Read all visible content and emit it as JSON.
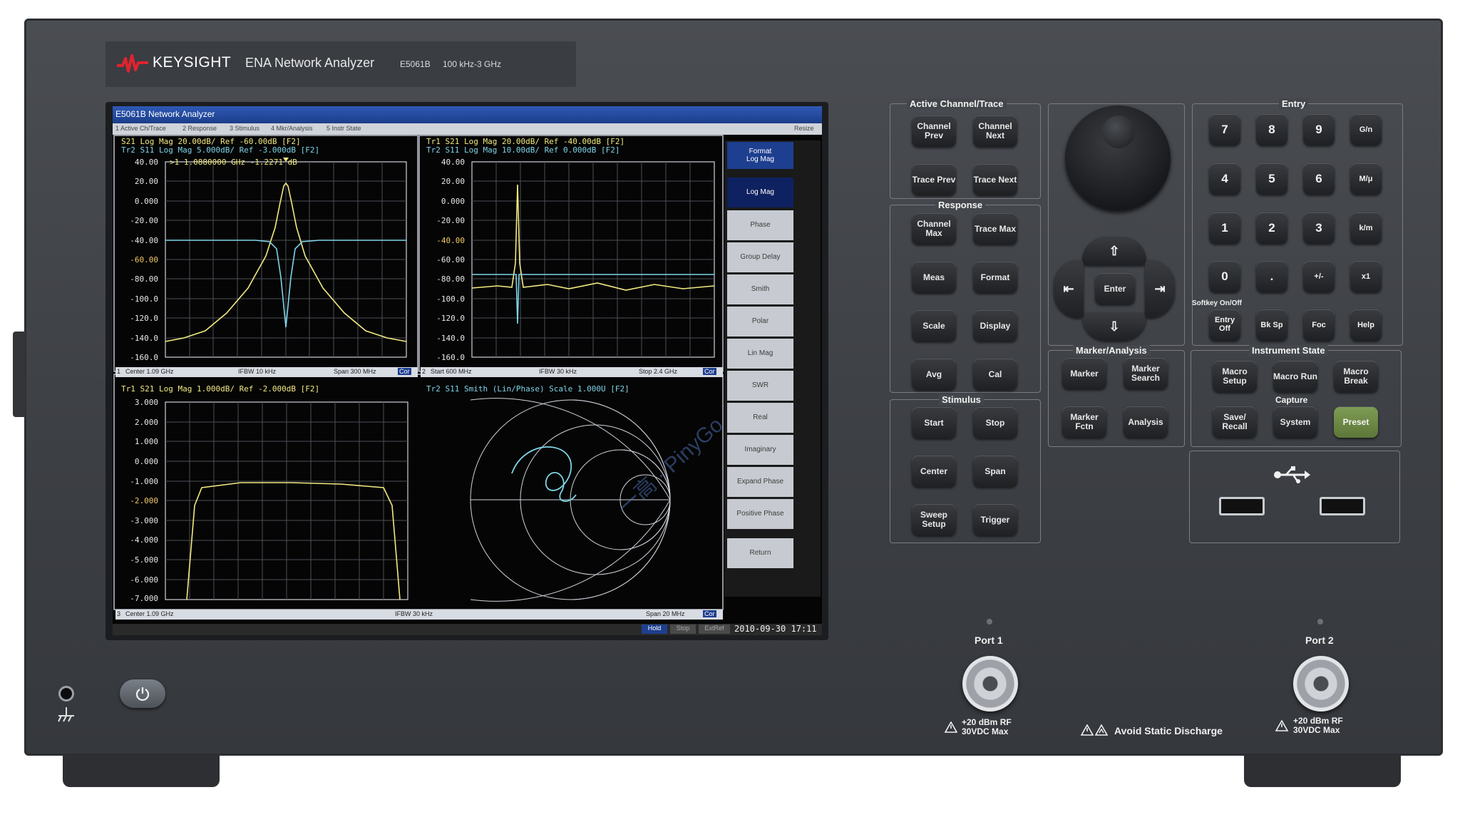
{
  "brand": {
    "logo_text": "KEYSIGHT",
    "product": "ENA Network Analyzer",
    "model": "E5061B",
    "range": "100 kHz-3 GHz"
  },
  "screen": {
    "window_title": "E5061B Network Analyzer",
    "menu": [
      "1 Active Ch/Trace",
      "2 Response",
      "3 Stimulus",
      "4 Mkr/Analysis",
      "5 Instr State"
    ],
    "menu_right": "Resize",
    "pane1": {
      "header1": "S21 Log Mag 20.00dB/ Ref -60.00dB [F2]",
      "header2": "Tr2 S11 Log Mag 5.000dB/ Ref -3.000dB [F2]",
      "marker": ">1  1.0880000 GHz  -1.2271 dB",
      "yticks": [
        "40.00",
        "20.00",
        "0.000",
        "-20.00",
        "-40.00",
        "-60.00",
        "-80.00",
        "-100.0",
        "-120.0",
        "-140.0",
        "-160.0"
      ],
      "status": {
        "ch": "1",
        "left": "Center 1.09 GHz",
        "mid": "IFBW 10 kHz",
        "right": "Span 300 MHz",
        "cor": "Cor"
      }
    },
    "pane2": {
      "header1": "Tr1 S21 Log Mag 20.00dB/ Ref -40.00dB [F2]",
      "header2": "Tr2 S11 Log Mag 10.00dB/ Ref 0.000dB [F2]",
      "yticks": [
        "40.00",
        "20.00",
        "0.000",
        "-20.00",
        "-40.00",
        "-60.00",
        "-80.00",
        "-100.0",
        "-120.0",
        "-140.0",
        "-160.0"
      ],
      "status": {
        "ch": "2",
        "left": "Start 600 MHz",
        "mid": "IFBW 30 kHz",
        "right": "Stop 2.4 GHz",
        "cor": "Cor"
      }
    },
    "pane3": {
      "header1": "Tr1 S21 Log Mag 1.000dB/ Ref -2.000dB [F2]",
      "yticks": [
        "3.000",
        "2.000",
        "1.000",
        "0.000",
        "-1.000",
        "-2.000",
        "-3.000",
        "-4.000",
        "-5.000",
        "-6.000",
        "-7.000"
      ],
      "status": {
        "ch": "3",
        "left": "Center 1.09 GHz",
        "mid": "IFBW 30 kHz",
        "right": "Span 20 MHz",
        "cor": "Cor"
      }
    },
    "pane4": {
      "header1": "Tr2 S11 Smith (Lin/Phase) Scale 1.000U [F2]"
    },
    "softkeys": {
      "header": [
        "Format",
        "Log Mag"
      ],
      "items": [
        "Log Mag",
        "Phase",
        "Group Delay",
        "Smith",
        "Polar",
        "Lin Mag",
        "SWR",
        "Real",
        "Imaginary",
        "Expand Phase",
        "Positive Phase",
        "Return"
      ]
    },
    "bottom_status": {
      "hold": "Hold",
      "stop": "Stop",
      "extref": "ExtRef",
      "datetime": "2010-09-30 17:11"
    }
  },
  "panel": {
    "active_channel": {
      "label": "Active Channel/Trace",
      "keys": [
        "Channel Prev",
        "Channel Next",
        "Trace Prev",
        "Trace Next"
      ]
    },
    "response": {
      "label": "Response",
      "keys": [
        "Channel Max",
        "Trace Max",
        "Meas",
        "Format",
        "Scale",
        "Display",
        "Avg",
        "Cal"
      ]
    },
    "stimulus": {
      "label": "Stimulus",
      "keys": [
        "Start",
        "Stop",
        "Center",
        "Span",
        "Sweep Setup",
        "Trigger"
      ]
    },
    "navigation": {
      "up": "⇧",
      "down": "⇩",
      "left": "⇤",
      "right": "⇥",
      "enter": "Enter"
    },
    "marker_analysis": {
      "label": "Marker/Analysis",
      "keys": [
        "Marker",
        "Marker Search",
        "Marker Fctn",
        "Analysis"
      ]
    },
    "entry": {
      "label": "Entry",
      "keys": [
        "7",
        "8",
        "9",
        "G/n",
        "4",
        "5",
        "6",
        "M/μ",
        "1",
        "2",
        "3",
        "k/m",
        "0",
        ".",
        "+/-",
        "x1"
      ],
      "softkey_label": "Softkey On/Off",
      "bottom_keys": [
        "Entry Off",
        "Bk Sp",
        "Foc",
        "Help"
      ]
    },
    "instrument_state": {
      "label": "Instrument State",
      "keys": [
        "Macro Setup",
        "Macro Run",
        "Macro Break"
      ],
      "capture_label": "Capture",
      "keys2": [
        "Save/ Recall",
        "System",
        "Preset"
      ]
    }
  },
  "ports": {
    "port1": {
      "label": "Port 1",
      "warn1": "+20 dBm RF",
      "warn2": "30VDC Max"
    },
    "port2": {
      "label": "Port 2",
      "warn1": "+20 dBm RF",
      "warn2": "30VDC Max"
    },
    "static_warning": "Avoid Static Discharge"
  },
  "watermark": "一高 · PinyGo",
  "colors": {
    "trace_yellow": "#f2ea82",
    "trace_cyan": "#7fd4e8",
    "preset_green": "#6f8a48",
    "title_blue": "#2e59b5"
  }
}
